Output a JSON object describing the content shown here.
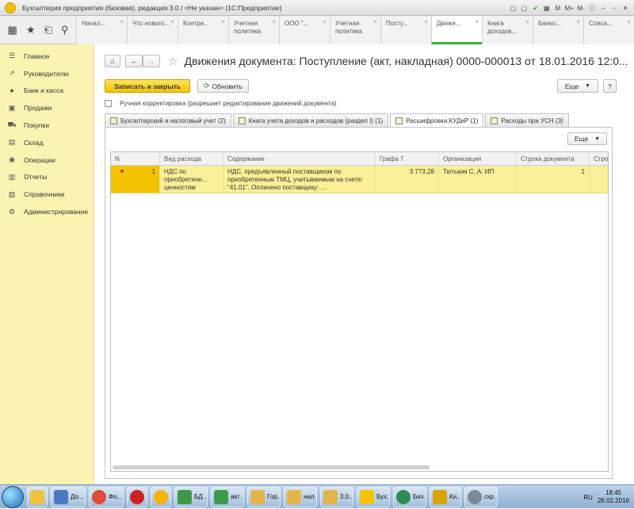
{
  "window": {
    "title": "Бухгалтерия предприятия (базовая), редакция 3.0 / <Не указан>  (1С:Предприятие)",
    "tools": [
      "M",
      "M+",
      "M-"
    ]
  },
  "nav_icons": [
    "grid-icon",
    "star-icon",
    "history-icon",
    "search-icon"
  ],
  "open_tabs": [
    {
      "label": "Начал...",
      "active": false
    },
    {
      "label": "Что нового...",
      "active": false
    },
    {
      "label": "Контра...",
      "active": false
    },
    {
      "label": "Учетная политика",
      "active": false
    },
    {
      "label": "ООО \"...",
      "active": false
    },
    {
      "label": "Учетная политика",
      "active": false
    },
    {
      "label": "Посту...",
      "active": false
    },
    {
      "label": "Движе...",
      "active": true
    },
    {
      "label": "Книга доходов...",
      "active": false
    },
    {
      "label": "Банко...",
      "active": false
    },
    {
      "label": "Списа...",
      "active": false
    }
  ],
  "sidebar": {
    "items": [
      {
        "label": "Главное",
        "icon": "menu-icon"
      },
      {
        "label": "Руководителю",
        "icon": "trend-icon"
      },
      {
        "label": "Банк и касса",
        "icon": "coins-icon"
      },
      {
        "label": "Продажи",
        "icon": "sales-icon"
      },
      {
        "label": "Покупки",
        "icon": "cart-icon"
      },
      {
        "label": "Склад",
        "icon": "warehouse-icon"
      },
      {
        "label": "Операции",
        "icon": "operations-icon"
      },
      {
        "label": "Отчеты",
        "icon": "reports-icon"
      },
      {
        "label": "Справочники",
        "icon": "books-icon"
      },
      {
        "label": "Администрирование",
        "icon": "gear-icon"
      }
    ]
  },
  "document": {
    "title": "Движения документа: Поступление (акт, накладная) 0000-000013 от 18.01.2016 12:0...",
    "save_close_label": "Записать и закрыть",
    "refresh_label": "Обновить",
    "more_label": "Еще",
    "help_label": "?",
    "manual_correction_label": "Ручная корректировка (разрешает редактирование движений документа)"
  },
  "doc_tabs": [
    {
      "label": "Бухгалтерский и налоговый учет (2)",
      "active": false
    },
    {
      "label": "Книга учета доходов и расходов (раздел I) (1)",
      "active": false
    },
    {
      "label": "Расшифровка КУДиР (1)",
      "active": true
    },
    {
      "label": "Расходы при УСН (3)",
      "active": false
    }
  ],
  "table": {
    "more_label": "Еще",
    "columns": [
      "N",
      "Вид расхода",
      "Содержание",
      "Графа 7",
      "Организация",
      "Строка документа",
      "Строка"
    ],
    "rows": [
      {
        "n": "1",
        "expense_type": "НДС по приобретенн... ценностям",
        "content": "НДС, предъявленный поставщиком по приобретенным ТМЦ, учитываемым на счете: \"41.01\". Оплачено поставщику: ...",
        "column7": "3 773,28",
        "organization": "Тютькин С. А. ИП",
        "doc_line": "1",
        "line": ""
      }
    ]
  },
  "taskbar": {
    "tasks": [
      {
        "label": "",
        "color": "#f0c040"
      },
      {
        "label": "До...",
        "color": "#4a78c2"
      },
      {
        "label": "Фо...",
        "color": "#dd4b39"
      },
      {
        "label": "",
        "color": "#cc2222"
      },
      {
        "label": "",
        "color": "#f5b400"
      },
      {
        "label": "БД ...",
        "color": "#3c9a4a"
      },
      {
        "label": "акт ...",
        "color": "#3c9a4a"
      },
      {
        "label": "Гор...",
        "color": "#e2b54a"
      },
      {
        "label": "нал...",
        "color": "#e2b54a"
      },
      {
        "label": "3.0...",
        "color": "#e2b54a"
      },
      {
        "label": "Бух...",
        "color": "#f3c200"
      },
      {
        "label": "Биз...",
        "color": "#2e8b57"
      },
      {
        "label": "Ки...",
        "color": "#d9a400"
      },
      {
        "label": "скр...",
        "color": "#7a8a99"
      }
    ],
    "lang": "RU",
    "time": "18:45",
    "date": "26.02.2016"
  }
}
